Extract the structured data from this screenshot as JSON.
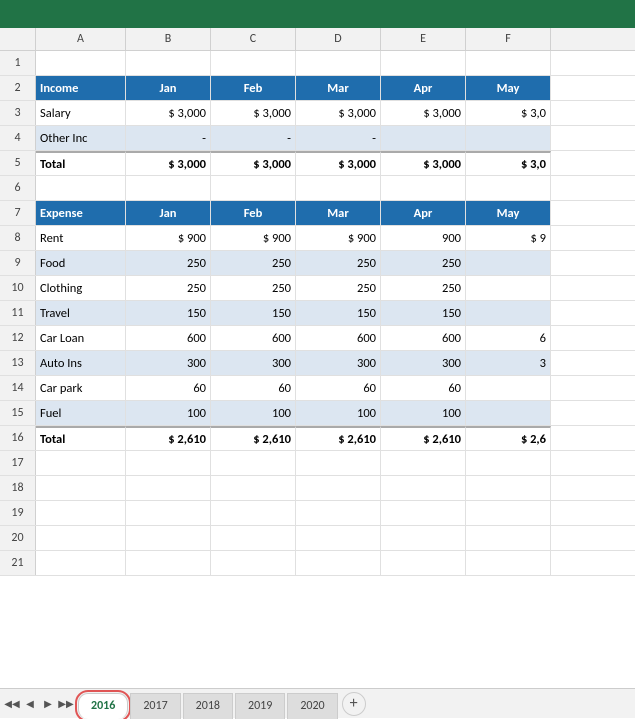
{
  "header": {
    "col_a": "A",
    "col_b": "B",
    "col_c": "C",
    "col_d": "D",
    "col_e": "E",
    "col_f": "F"
  },
  "rows": [
    {
      "num": "1",
      "a": "",
      "b": "",
      "c": "",
      "d": "",
      "e": "",
      "f": "",
      "type": "empty"
    },
    {
      "num": "2",
      "a": "Income",
      "b": "Jan",
      "c": "Feb",
      "d": "Mar",
      "e": "Apr",
      "f": "May",
      "type": "income-header"
    },
    {
      "num": "3",
      "a": "Salary",
      "b": "$ 3,000",
      "c": "$ 3,000",
      "d": "$ 3,000",
      "e": "$ 3,000",
      "f": "$ 3,0",
      "type": "data-light"
    },
    {
      "num": "4",
      "a": "Other Inc",
      "b": "-",
      "c": "-",
      "d": "-",
      "e": "",
      "f": "",
      "type": "data-blue"
    },
    {
      "num": "5",
      "a": "Total",
      "b": "$ 3,000",
      "c": "$ 3,000",
      "d": "$ 3,000",
      "e": "$ 3,000",
      "f": "$ 3,0",
      "type": "total"
    },
    {
      "num": "6",
      "a": "",
      "b": "",
      "c": "",
      "d": "",
      "e": "",
      "f": "",
      "type": "empty"
    },
    {
      "num": "7",
      "a": "Expense",
      "b": "Jan",
      "c": "Feb",
      "d": "Mar",
      "e": "Apr",
      "f": "May",
      "type": "expense-header"
    },
    {
      "num": "8",
      "a": "Rent",
      "b": "$  900",
      "c": "$  900",
      "d": "$  900",
      "e": "  900",
      "f": "$  9",
      "type": "data-light"
    },
    {
      "num": "9",
      "a": "Food",
      "b": "250",
      "c": "250",
      "d": "250",
      "e": "250",
      "f": "",
      "type": "data-blue"
    },
    {
      "num": "10",
      "a": "Clothing",
      "b": "250",
      "c": "250",
      "d": "250",
      "e": "250",
      "f": "",
      "type": "data-light"
    },
    {
      "num": "11",
      "a": "Travel",
      "b": "150",
      "c": "150",
      "d": "150",
      "e": "150",
      "f": "",
      "type": "data-blue"
    },
    {
      "num": "12",
      "a": "Car Loan",
      "b": "600",
      "c": "600",
      "d": "600",
      "e": "600",
      "f": "6",
      "type": "data-light"
    },
    {
      "num": "13",
      "a": "Auto Ins",
      "b": "300",
      "c": "300",
      "d": "300",
      "e": "300",
      "f": "3",
      "type": "data-blue"
    },
    {
      "num": "14",
      "a": "Car park",
      "b": "60",
      "c": "60",
      "d": "60",
      "e": "60",
      "f": "",
      "type": "data-light"
    },
    {
      "num": "15",
      "a": "Fuel",
      "b": "100",
      "c": "100",
      "d": "100",
      "e": "100",
      "f": "",
      "type": "data-blue"
    },
    {
      "num": "16",
      "a": "Total",
      "b": "$ 2,610",
      "c": "$ 2,610",
      "d": "$ 2,610",
      "e": "$ 2,610",
      "f": "$ 2,6",
      "type": "total"
    },
    {
      "num": "17",
      "a": "",
      "b": "",
      "c": "",
      "d": "",
      "e": "",
      "f": "",
      "type": "empty"
    },
    {
      "num": "18",
      "a": "",
      "b": "",
      "c": "",
      "d": "",
      "e": "",
      "f": "",
      "type": "empty"
    },
    {
      "num": "19",
      "a": "",
      "b": "",
      "c": "",
      "d": "",
      "e": "",
      "f": "",
      "type": "empty"
    },
    {
      "num": "20",
      "a": "",
      "b": "",
      "c": "",
      "d": "",
      "e": "",
      "f": "",
      "type": "empty"
    },
    {
      "num": "21",
      "a": "",
      "b": "",
      "c": "",
      "d": "",
      "e": "",
      "f": "",
      "type": "empty"
    }
  ],
  "tabs": [
    {
      "label": "2016",
      "active": true
    },
    {
      "label": "2017",
      "active": false
    },
    {
      "label": "2018",
      "active": false
    },
    {
      "label": "2019",
      "active": false
    },
    {
      "label": "2020",
      "active": false
    }
  ],
  "add_tab_label": "+"
}
